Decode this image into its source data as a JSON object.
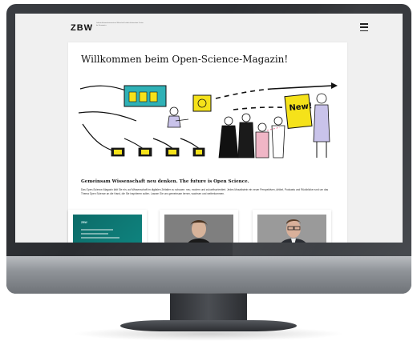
{
  "site": {
    "logo": "ZBW",
    "logo_sub": "Leibniz-Informationszentrum Wirtschaft Leibniz Information Centre for Economics",
    "title": "Willkommen beim Open-Science-Magazin!",
    "subheading": "Gemeinsam Wissenschaft neu denken. The future is Open Science.",
    "intro": "Das Open-Science-Magazin lädt Sie ein, auf Wissenschaft im digitalen Zeitalter zu schauen: neu, modern und zukunftsorientiert. Jedes Mosaikstein ein neuer Perspektiven, Artikel, Podcasts und Rückblicke rund um das Thema Open Science an die Hand, die Sie inspirieren sollen. Lassen Sie uns gemeinsam lernen, wachsen und weiterkommen.",
    "hero_sign": "New!",
    "menu_icon": "hamburger-menu-icon"
  },
  "cards": [
    {
      "label": "ZBW",
      "kind": "teal-text"
    },
    {
      "label": "",
      "kind": "portrait-woman"
    },
    {
      "label": "",
      "kind": "portrait-man"
    }
  ],
  "colors": {
    "teal": "#0c6b68",
    "sign_yellow": "#f5e21a",
    "bezel": "#2c2e32"
  }
}
